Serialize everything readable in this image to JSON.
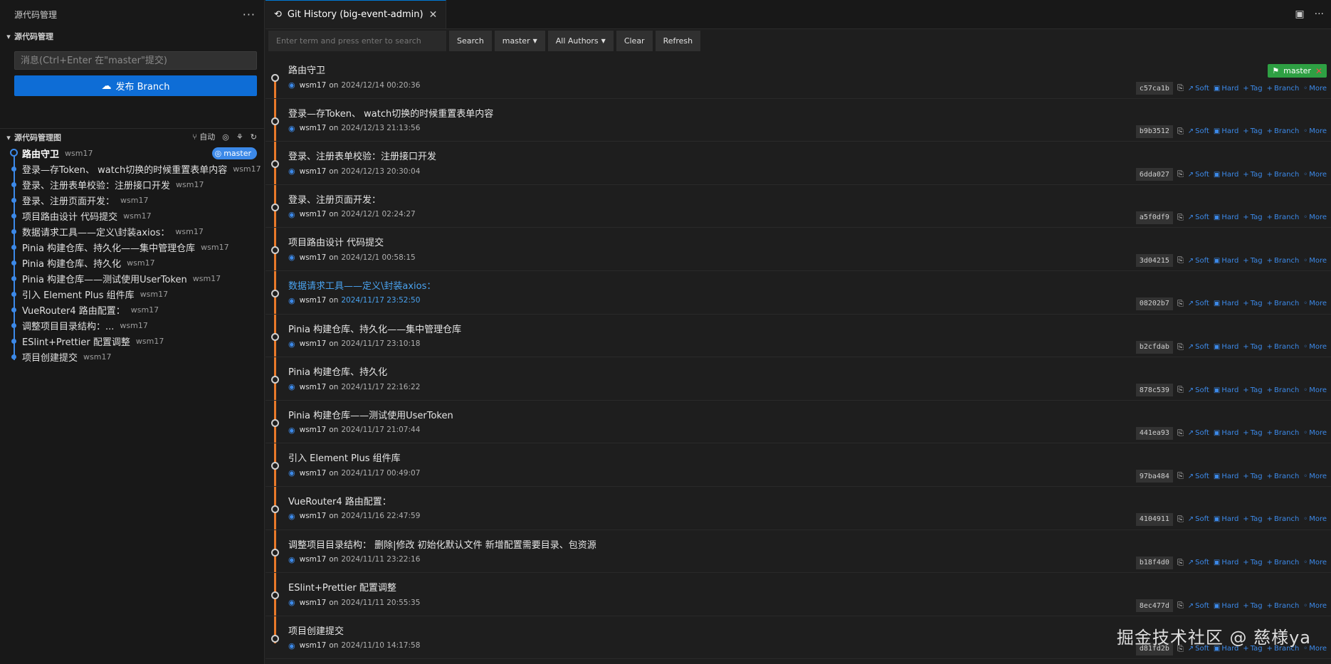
{
  "sidebar": {
    "title": "源代码管理",
    "more": "···",
    "section_title": "源代码管理",
    "commit_placeholder": "消息(Ctrl+Enter 在\"master\"提交)",
    "publish_label": "发布 Branch",
    "graph_title": "源代码管理图",
    "graph_auto": "自动",
    "graph_items": [
      {
        "msg": "路由守卫",
        "author": "wsm17",
        "badge": "master"
      },
      {
        "msg": "登录—存Token、 watch切换的时候重置表单内容",
        "author": "wsm17"
      },
      {
        "msg": "登录、注册表单校验：注册接口开发",
        "author": "wsm17"
      },
      {
        "msg": "登录、注册页面开发：",
        "author": "wsm17"
      },
      {
        "msg": " 项目路由设计 代码提交",
        "author": "wsm17"
      },
      {
        "msg": "数据请求工具——定义\\封装axios：",
        "author": "wsm17"
      },
      {
        "msg": "Pinia 构建仓库、持久化——集中管理仓库",
        "author": "wsm17"
      },
      {
        "msg": "Pinia 构建仓库、持久化",
        "author": "wsm17"
      },
      {
        "msg": "Pinia 构建仓库——测试使用UserToken",
        "author": "wsm17"
      },
      {
        "msg": "引入 Element Plus 组件库",
        "author": "wsm17"
      },
      {
        "msg": "VueRouter4 路由配置：",
        "author": "wsm17"
      },
      {
        "msg": "调整项目目录结构：...",
        "author": "wsm17"
      },
      {
        "msg": "ESlint+Prettier 配置调整",
        "author": "wsm17"
      },
      {
        "msg": "项目创建提交",
        "author": "wsm17"
      }
    ]
  },
  "tab": {
    "label": "Git History (big-event-admin)",
    "close": "✕"
  },
  "toolbar": {
    "search_placeholder": "Enter term and press enter to search",
    "search_btn": "Search",
    "branch_btn": "master",
    "authors_btn": "All Authors",
    "clear_btn": "Clear",
    "refresh_btn": "Refresh"
  },
  "history": {
    "branch_pill": "master",
    "on_word": "on",
    "action_labels": {
      "soft": "Soft",
      "hard": "Hard",
      "tag": "Tag",
      "branch": "Branch",
      "more": "More"
    },
    "commits": [
      {
        "msg": "路由守卫",
        "author": "wsm17",
        "date": "2024/12/14 00:20:36",
        "hash": "c57ca1b"
      },
      {
        "msg": "登录—存Token、 watch切换的时候重置表单内容",
        "author": "wsm17",
        "date": "2024/12/13 21:13:56",
        "hash": "b9b3512"
      },
      {
        "msg": "登录、注册表单校验：注册接口开发",
        "author": "wsm17",
        "date": "2024/12/13 20:30:04",
        "hash": "6dda027"
      },
      {
        "msg": "登录、注册页面开发：",
        "author": "wsm17",
        "date": "2024/12/1 02:24:27",
        "hash": "a5f0df9"
      },
      {
        "msg": "项目路由设计 代码提交",
        "author": "wsm17",
        "date": "2024/12/1 00:58:15",
        "hash": "3d04215"
      },
      {
        "msg": "数据请求工具——定义\\封装axios：",
        "author": "wsm17",
        "date": "2024/11/17 23:52:50",
        "hash": "08202b7",
        "highlight": true
      },
      {
        "msg": "Pinia 构建仓库、持久化——集中管理仓库",
        "author": "wsm17",
        "date": "2024/11/17 23:10:18",
        "hash": "b2cfdab"
      },
      {
        "msg": "Pinia 构建仓库、持久化",
        "author": "wsm17",
        "date": "2024/11/17 22:16:22",
        "hash": "878c539"
      },
      {
        "msg": "Pinia 构建仓库——测试使用UserToken",
        "author": "wsm17",
        "date": "2024/11/17 21:07:44",
        "hash": "441ea93"
      },
      {
        "msg": "引入 Element Plus 组件库",
        "author": "wsm17",
        "date": "2024/11/17 00:49:07",
        "hash": "97ba484"
      },
      {
        "msg": "VueRouter4 路由配置：",
        "author": "wsm17",
        "date": "2024/11/16 22:47:59",
        "hash": "4104911"
      },
      {
        "msg": "调整项目目录结构： 删除|修改 初始化默认文件 新增配置需要目录、包资源",
        "author": "wsm17",
        "date": "2024/11/11 23:22:16",
        "hash": "b18f4d0"
      },
      {
        "msg": "ESlint+Prettier 配置调整",
        "author": "wsm17",
        "date": "2024/11/11 20:55:35",
        "hash": "8ec477d"
      },
      {
        "msg": "项目创建提交",
        "author": "wsm17",
        "date": "2024/11/10 14:17:58",
        "hash": "d81fd2b"
      }
    ]
  },
  "watermark": "掘金技术社区 @ 慈様ya",
  "colors": {
    "accent": "#0e6dd6",
    "graph_line": "#3c89e8",
    "history_line": "#e8792a",
    "branch_pill": "#2ea043"
  }
}
